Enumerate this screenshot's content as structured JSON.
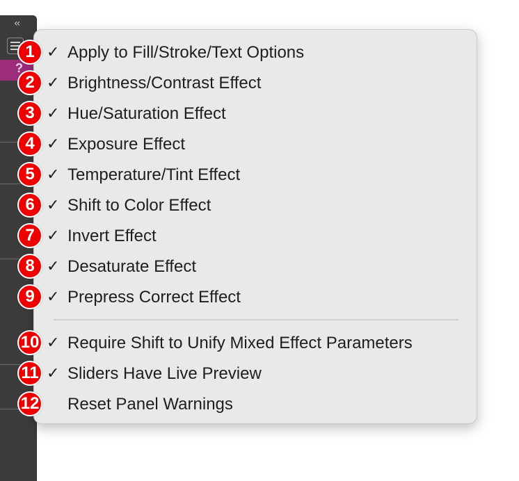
{
  "panel": {
    "collapse_glyph": "‹‹",
    "help_glyph": "?",
    "accent_color": "#9b2d7b"
  },
  "menu": {
    "items": [
      {
        "number": "1",
        "label": "Apply to Fill/Stroke/Text Options",
        "checked": true,
        "check": "✓"
      },
      {
        "number": "2",
        "label": "Brightness/Contrast Effect",
        "checked": true,
        "check": "✓"
      },
      {
        "number": "3",
        "label": "Hue/Saturation Effect",
        "checked": true,
        "check": "✓"
      },
      {
        "number": "4",
        "label": "Exposure Effect",
        "checked": true,
        "check": "✓"
      },
      {
        "number": "5",
        "label": "Temperature/Tint Effect",
        "checked": true,
        "check": "✓"
      },
      {
        "number": "6",
        "label": "Shift to Color Effect",
        "checked": true,
        "check": "✓"
      },
      {
        "number": "7",
        "label": "Invert Effect",
        "checked": true,
        "check": "✓"
      },
      {
        "number": "8",
        "label": "Desaturate Effect",
        "checked": true,
        "check": "✓"
      },
      {
        "number": "9",
        "label": "Prepress Correct Effect",
        "checked": true,
        "check": "✓"
      },
      {
        "number": "10",
        "label": "Require Shift to Unify Mixed Effect Parameters",
        "checked": true,
        "check": "✓"
      },
      {
        "number": "11",
        "label": "Sliders Have Live Preview",
        "checked": true,
        "check": "✓"
      },
      {
        "number": "12",
        "label": "Reset Panel Warnings",
        "checked": false,
        "check": ""
      }
    ]
  },
  "badge_color": "#ee0000"
}
